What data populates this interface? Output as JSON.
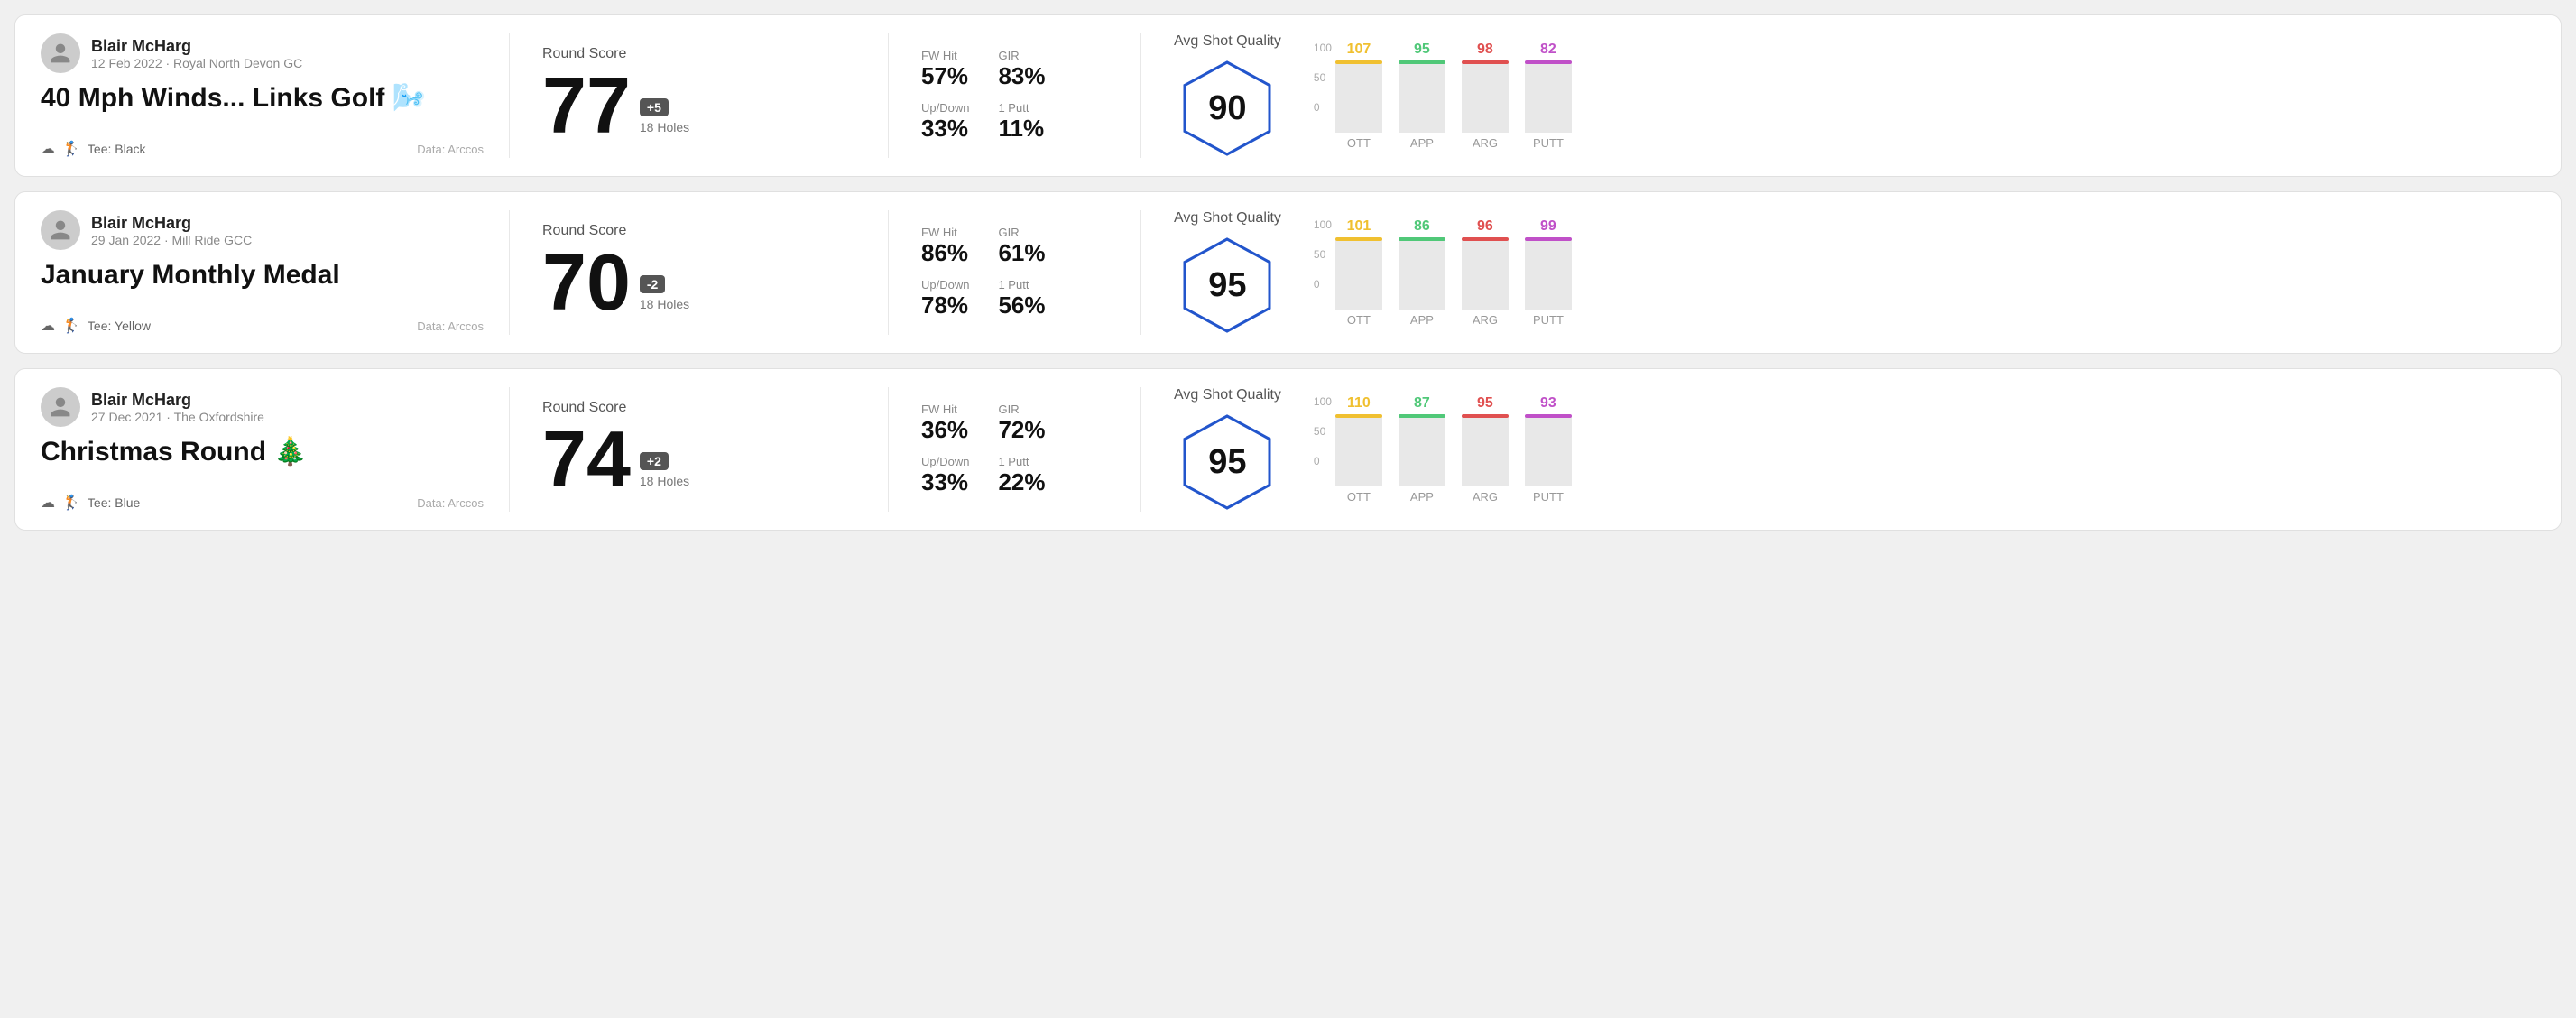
{
  "rounds": [
    {
      "id": "round1",
      "user": {
        "name": "Blair McHarg",
        "date": "12 Feb 2022",
        "course": "Royal North Devon GC"
      },
      "title": "40 Mph Winds... Links Golf",
      "title_emoji": "🌬️",
      "tee": "Black",
      "data_source": "Data: Arccos",
      "round_score_label": "Round Score",
      "score": "77",
      "score_diff": "+5",
      "holes": "18 Holes",
      "fw_hit_label": "FW Hit",
      "fw_hit": "57%",
      "gir_label": "GIR",
      "gir": "83%",
      "updown_label": "Up/Down",
      "updown": "33%",
      "oneputt_label": "1 Putt",
      "oneputt": "11%",
      "avg_shot_quality_label": "Avg Shot Quality",
      "quality_score": "90",
      "chart": {
        "bars": [
          {
            "label": "OTT",
            "value": 107,
            "color": "#f0c030",
            "fill_pct": 72
          },
          {
            "label": "APP",
            "value": 95,
            "color": "#50c878",
            "fill_pct": 62
          },
          {
            "label": "ARG",
            "value": 98,
            "color": "#e05050",
            "fill_pct": 65
          },
          {
            "label": "PUTT",
            "value": 82,
            "color": "#c050c8",
            "fill_pct": 54
          }
        ]
      }
    },
    {
      "id": "round2",
      "user": {
        "name": "Blair McHarg",
        "date": "29 Jan 2022",
        "course": "Mill Ride GCC"
      },
      "title": "January Monthly Medal",
      "title_emoji": "",
      "tee": "Yellow",
      "data_source": "Data: Arccos",
      "round_score_label": "Round Score",
      "score": "70",
      "score_diff": "-2",
      "holes": "18 Holes",
      "fw_hit_label": "FW Hit",
      "fw_hit": "86%",
      "gir_label": "GIR",
      "gir": "61%",
      "updown_label": "Up/Down",
      "updown": "78%",
      "oneputt_label": "1 Putt",
      "oneputt": "56%",
      "avg_shot_quality_label": "Avg Shot Quality",
      "quality_score": "95",
      "chart": {
        "bars": [
          {
            "label": "OTT",
            "value": 101,
            "color": "#f0c030",
            "fill_pct": 68
          },
          {
            "label": "APP",
            "value": 86,
            "color": "#50c878",
            "fill_pct": 56
          },
          {
            "label": "ARG",
            "value": 96,
            "color": "#e05050",
            "fill_pct": 64
          },
          {
            "label": "PUTT",
            "value": 99,
            "color": "#c050c8",
            "fill_pct": 66
          }
        ]
      }
    },
    {
      "id": "round3",
      "user": {
        "name": "Blair McHarg",
        "date": "27 Dec 2021",
        "course": "The Oxfordshire"
      },
      "title": "Christmas Round",
      "title_emoji": "🎄",
      "tee": "Blue",
      "data_source": "Data: Arccos",
      "round_score_label": "Round Score",
      "score": "74",
      "score_diff": "+2",
      "holes": "18 Holes",
      "fw_hit_label": "FW Hit",
      "fw_hit": "36%",
      "gir_label": "GIR",
      "gir": "72%",
      "updown_label": "Up/Down",
      "updown": "33%",
      "oneputt_label": "1 Putt",
      "oneputt": "22%",
      "avg_shot_quality_label": "Avg Shot Quality",
      "quality_score": "95",
      "chart": {
        "bars": [
          {
            "label": "OTT",
            "value": 110,
            "color": "#f0c030",
            "fill_pct": 74
          },
          {
            "label": "APP",
            "value": 87,
            "color": "#50c878",
            "fill_pct": 57
          },
          {
            "label": "ARG",
            "value": 95,
            "color": "#e05050",
            "fill_pct": 63
          },
          {
            "label": "PUTT",
            "value": 93,
            "color": "#c050c8",
            "fill_pct": 62
          }
        ]
      }
    }
  ]
}
